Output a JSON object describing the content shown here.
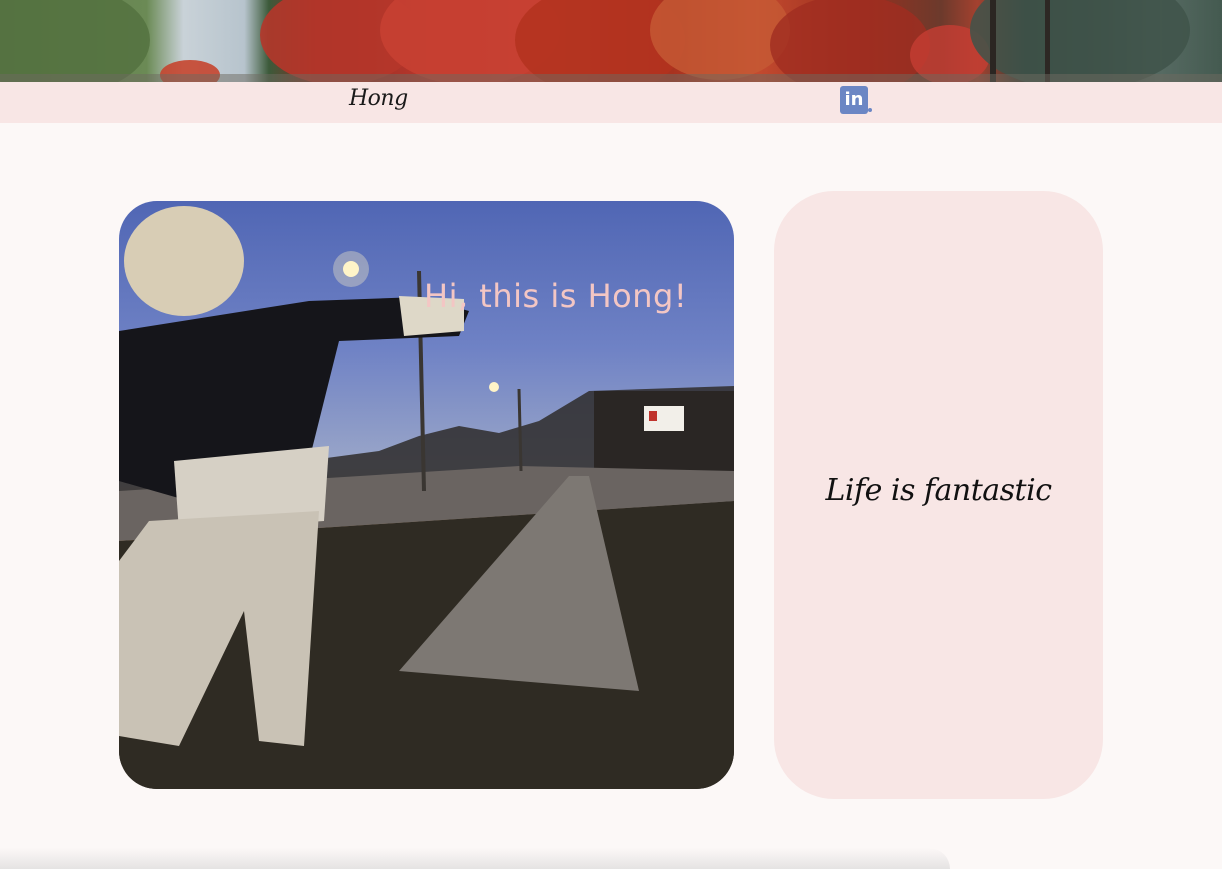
{
  "header": {
    "brand": "Hong",
    "social": {
      "icon": "linkedin-icon",
      "label": "in",
      "color": "#6b86c4"
    }
  },
  "hero": {
    "title": "Hi, this is Hong!",
    "image": "person-pointing-at-dusk-street-photo"
  },
  "side_card": {
    "tagline": "Life is fantastic"
  },
  "colors": {
    "page_background": "#fcf8f7",
    "nav_background": "#f8e6e5",
    "card_background": "#f8e6e5",
    "hero_title": "#f3c6c4"
  }
}
